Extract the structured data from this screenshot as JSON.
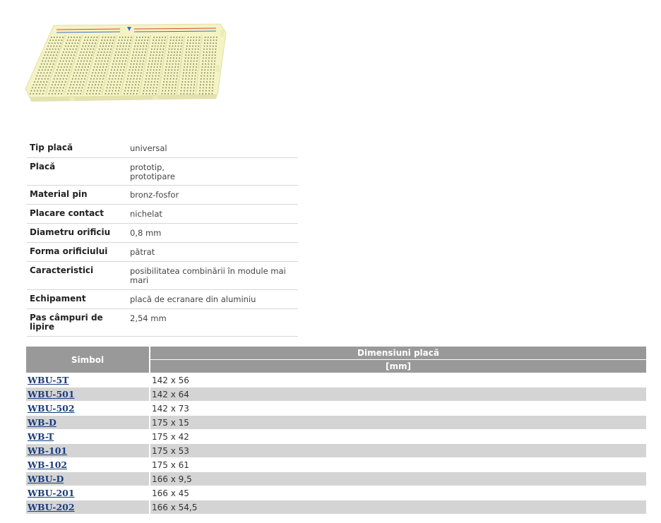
{
  "product_image": {
    "icon": "breadboard-image",
    "colors": {
      "board": "#f4f3c4",
      "hole": "#7e7e5a",
      "rail_red": "#d84a3a",
      "rail_blue": "#3c6fd0"
    }
  },
  "specs": [
    {
      "label": "Tip placă",
      "values": [
        "universal"
      ]
    },
    {
      "label": "Placă",
      "values": [
        "prototip,",
        "prototipare"
      ]
    },
    {
      "label": "Material pin",
      "values": [
        "bronz-fosfor"
      ]
    },
    {
      "label": "Placare contact",
      "values": [
        "nichelat"
      ]
    },
    {
      "label": "Diametru orificiu",
      "values": [
        "0,8 mm"
      ]
    },
    {
      "label": "Forma orificiului",
      "values": [
        "pătrat"
      ]
    },
    {
      "label": "Caracteristici",
      "values": [
        "posibilitatea combinării în module mai mari"
      ]
    },
    {
      "label": "Echipament",
      "values": [
        "placă de ecranare din aluminiu"
      ]
    },
    {
      "label": "Pas câmpuri de lipire",
      "values": [
        "2,54 mm"
      ]
    }
  ],
  "sizes_table": {
    "header_symbol": "Simbol",
    "header_dimensions": "Dimensiuni placă",
    "header_unit": "[mm]",
    "rows": [
      {
        "symbol": "WBU-5T",
        "dimensions": "142 x 56"
      },
      {
        "symbol": "WBU-501",
        "dimensions": "142 x 64"
      },
      {
        "symbol": "WBU-502",
        "dimensions": "142 x 73"
      },
      {
        "symbol": "WB-D",
        "dimensions": "175 x 15"
      },
      {
        "symbol": "WB-T",
        "dimensions": "175 x 42"
      },
      {
        "symbol": "WB-101",
        "dimensions": "175 x 53"
      },
      {
        "symbol": "WB-102",
        "dimensions": "175 x 61"
      },
      {
        "symbol": "WBU-D",
        "dimensions": "166 x 9,5"
      },
      {
        "symbol": "WBU-201",
        "dimensions": "166 x 45"
      },
      {
        "symbol": "WBU-202",
        "dimensions": "166 x 54,5"
      }
    ]
  }
}
